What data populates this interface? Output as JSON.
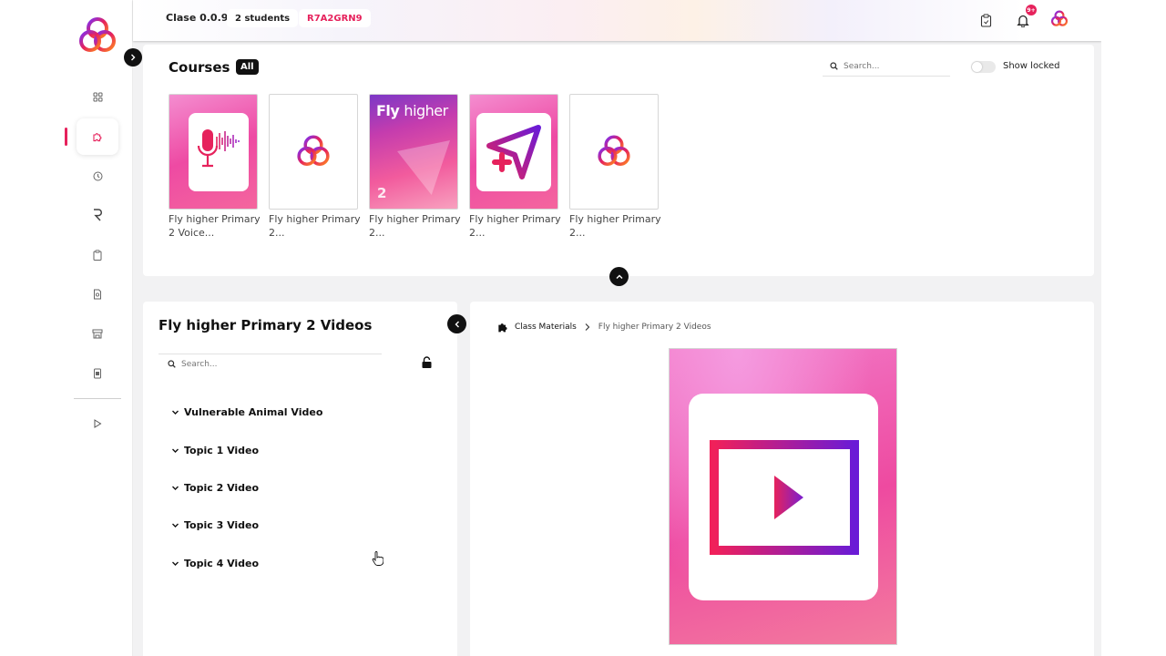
{
  "topbar": {
    "app_version": "Clase 0.0.9",
    "students": "2 students",
    "class_code": "R7A2GRN9",
    "notification_count": "9+"
  },
  "courses": {
    "title": "Courses",
    "filter_chip": "All",
    "search_placeholder": "Search...",
    "show_locked_label": "Show locked",
    "show_locked_on": false,
    "items": [
      {
        "title": "Fly higher Primary 2 Voice...",
        "thumb": "microphone-icon"
      },
      {
        "title": "Fly higher Primary 2...",
        "thumb": "app-logo"
      },
      {
        "title": "Fly higher Primary 2...",
        "thumb": "book-cover",
        "cover_brand": "Fly",
        "cover_brand_rest": "higher",
        "cover_level": "2"
      },
      {
        "title": "Fly higher Primary 2...",
        "thumb": "plus-send-icon"
      },
      {
        "title": "Fly higher Primary 2...",
        "thumb": "app-logo"
      }
    ]
  },
  "topics": {
    "title": "Fly higher Primary 2 Videos",
    "search_placeholder": "Search...",
    "items": [
      {
        "label": "Vulnerable Animal Video"
      },
      {
        "label": "Topic 1 Video"
      },
      {
        "label": "Topic 2 Video"
      },
      {
        "label": "Topic 3 Video"
      },
      {
        "label": "Topic 4 Video"
      }
    ]
  },
  "content": {
    "breadcrumb": [
      "Class Materials",
      "Fly higher Primary 2 Videos"
    ]
  },
  "colors": {
    "accent": "#e6225c",
    "pink": "#ee4aa3",
    "purple": "#6a1bd6"
  }
}
